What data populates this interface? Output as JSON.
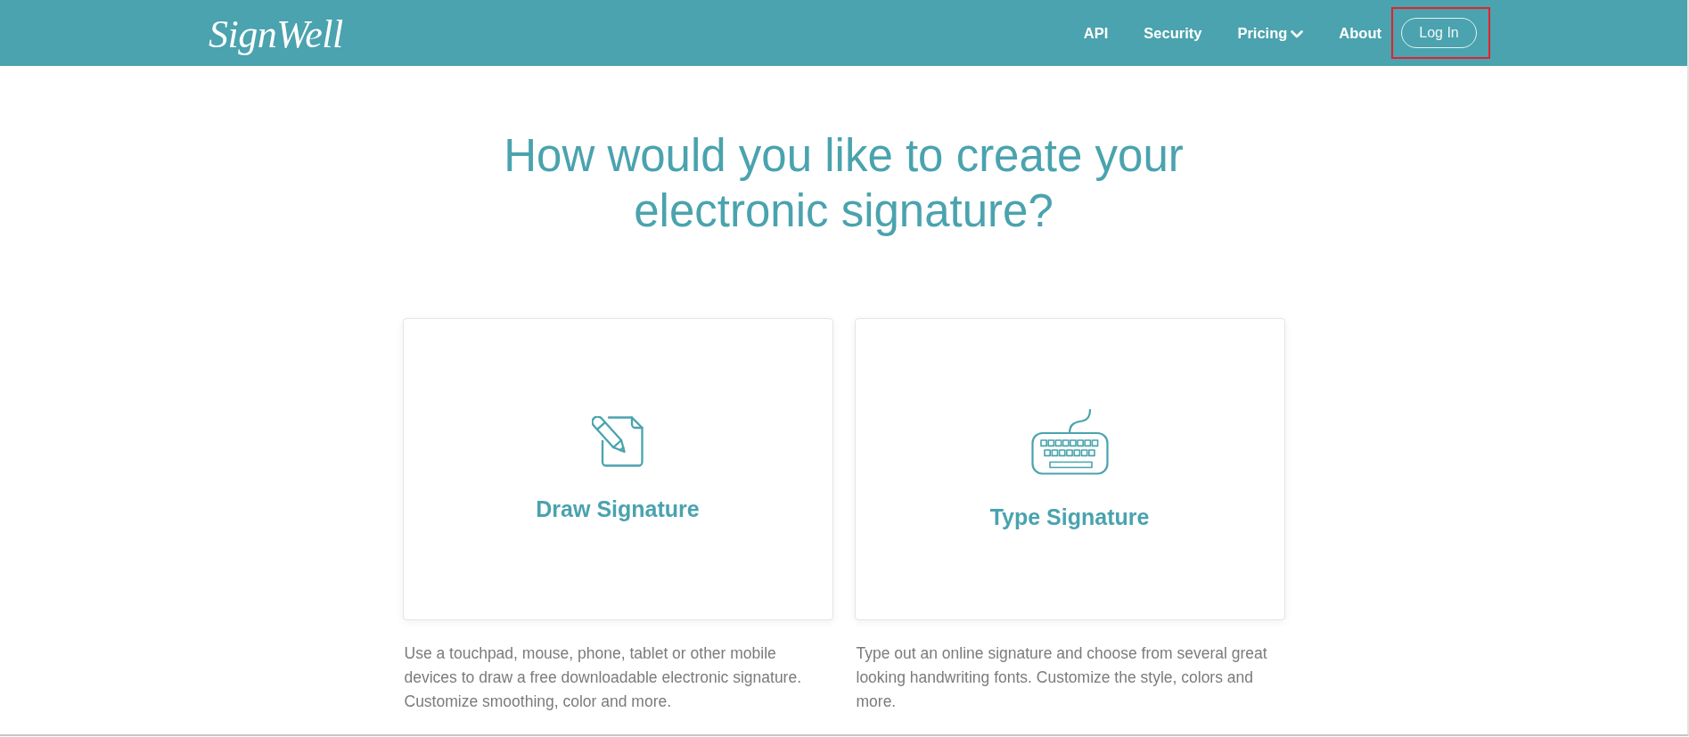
{
  "header": {
    "logo": "SignWell",
    "nav": [
      {
        "label": "API",
        "kind": "link",
        "dropdown": false,
        "highlighted": false
      },
      {
        "label": "Security",
        "kind": "link",
        "dropdown": false,
        "highlighted": false
      },
      {
        "label": "Pricing",
        "kind": "link",
        "dropdown": true,
        "highlighted": false
      },
      {
        "label": "About",
        "kind": "link",
        "dropdown": false,
        "highlighted": false
      },
      {
        "label": "Log In",
        "kind": "button",
        "dropdown": false,
        "highlighted": true
      }
    ]
  },
  "heading": "How would you like to create your electronic signature?",
  "options": [
    {
      "kind": "draw",
      "title": "Draw Signature",
      "description": "Use a touchpad, mouse, phone, tablet or other mobile devices to draw a free downloadable electronic signature. Customize smoothing, color and more."
    },
    {
      "kind": "type",
      "title": "Type Signature",
      "description": "Type out an online signature and choose from several great looking handwriting fonts. Customize the style, colors and more."
    }
  ]
}
